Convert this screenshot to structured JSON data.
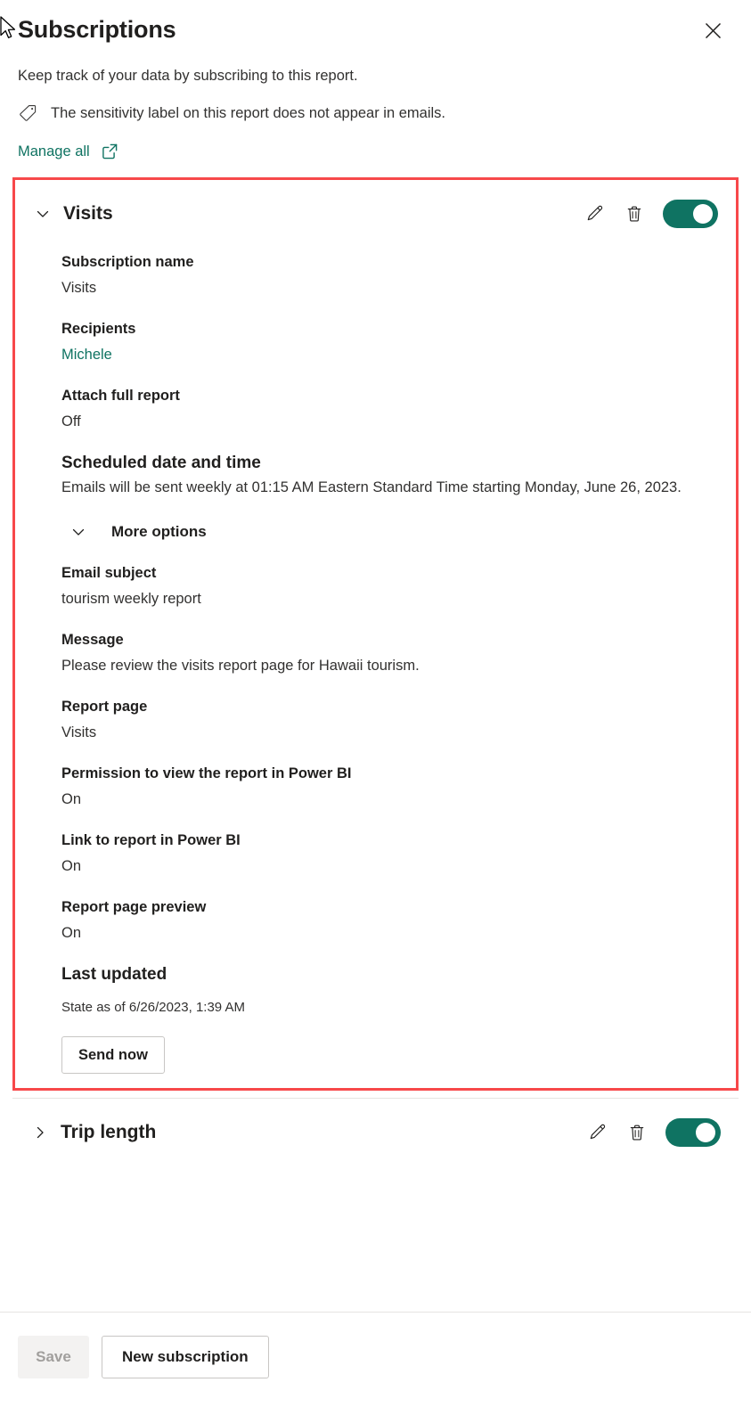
{
  "panel": {
    "title": "Subscriptions",
    "close_label": "Close",
    "subtitle": "Keep track of your data by subscribing to this report.",
    "sensitivity_notice": "The sensitivity label on this report does not appear in emails.",
    "manage_all_label": "Manage all"
  },
  "colors": {
    "accent_green": "#0f7362",
    "toggle_on": "#0f7362",
    "highlight_border": "#f7484a",
    "text_primary": "#201f1e",
    "text_secondary": "#323130",
    "disabled_text": "#a19f9d",
    "disabled_bg": "#f3f2f1"
  },
  "subscriptions": [
    {
      "name": "Visits",
      "expanded": true,
      "toggle_state": "On",
      "chevron": "chevron-down",
      "fields": [
        {
          "label": "Subscription name",
          "value": "Visits",
          "style": "plain"
        },
        {
          "label": "Recipients",
          "value": "Michele",
          "style": "link"
        },
        {
          "label": "Attach full report",
          "value": "Off",
          "style": "plain"
        },
        {
          "label": "Scheduled date and time",
          "value": "Emails will be sent weekly at 01:15 AM Eastern Standard Time starting Monday, June 26, 2023.",
          "style": "tight"
        }
      ],
      "more_options": {
        "label": "More options",
        "expanded": true,
        "fields": [
          {
            "label": "Email subject",
            "value": "tourism weekly report",
            "style": "plain"
          },
          {
            "label": "Message",
            "value": "Please review the visits report page for Hawaii tourism.",
            "style": "plain"
          },
          {
            "label": "Report page",
            "value": "Visits",
            "style": "plain"
          },
          {
            "label": "Permission to view the report in Power BI",
            "value": "On",
            "style": "plain"
          },
          {
            "label": "Link to report in Power BI",
            "value": "On",
            "style": "plain"
          },
          {
            "label": "Report page preview",
            "value": "On",
            "style": "plain"
          }
        ]
      },
      "last_updated": {
        "label": "Last updated",
        "state_text": "State as of 6/26/2023, 1:39 AM"
      },
      "send_now_label": "Send now"
    },
    {
      "name": "Trip length",
      "expanded": false,
      "toggle_state": "On",
      "chevron": "chevron-right"
    }
  ],
  "footer": {
    "save_label": "Save",
    "save_disabled": true,
    "new_subscription_label": "New subscription"
  }
}
